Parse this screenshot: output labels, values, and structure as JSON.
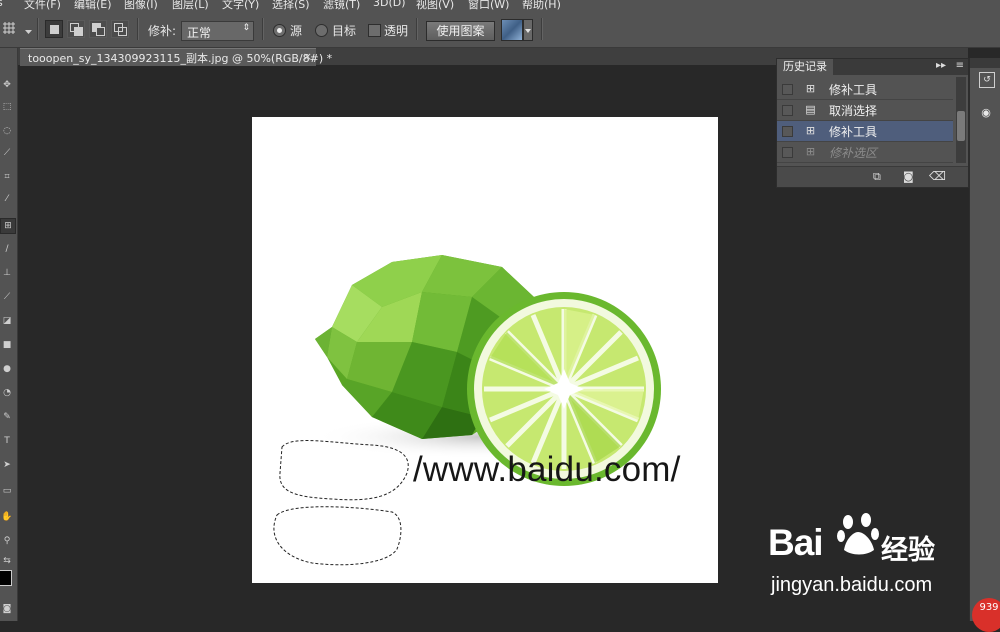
{
  "menu": [
    "文件(F)",
    "编辑(E)",
    "图像(I)",
    "图层(L)",
    "文字(Y)",
    "选择(S)",
    "滤镜(T)",
    "3D(D)",
    "视图(V)",
    "窗口(W)",
    "帮助(H)"
  ],
  "options": {
    "patch_label": "修补:",
    "patch_mode": "正常",
    "source_label": "源",
    "target_label": "目标",
    "transparent_label": "透明",
    "use_pattern_label": "使用图案"
  },
  "document_tab": {
    "title": "tooopen_sy_134309923115_副本.jpg @ 50%(RGB/8#) *",
    "close": "×"
  },
  "canvas": {
    "url_text": "/www.baidu.com/"
  },
  "history": {
    "title": "历史记录",
    "items": [
      {
        "label": "修补工具",
        "icon": "patch-tool-icon",
        "state": "normal"
      },
      {
        "label": "取消选择",
        "icon": "document-icon",
        "state": "normal"
      },
      {
        "label": "修补工具",
        "icon": "patch-tool-icon",
        "state": "selected"
      },
      {
        "label": "修补选区",
        "icon": "patch-tool-icon",
        "state": "dimmed"
      }
    ]
  },
  "watermark": {
    "brand": "Bai",
    "brand_suffix": "经验",
    "url": "jingyan.baidu.com"
  },
  "badge": "939",
  "colors": {
    "ui_panel": "#535353",
    "workspace": "#282828",
    "history_selected": "#4f5e7c",
    "lime_dark": "#3c8a1c",
    "lime_light": "#b8e24a"
  }
}
